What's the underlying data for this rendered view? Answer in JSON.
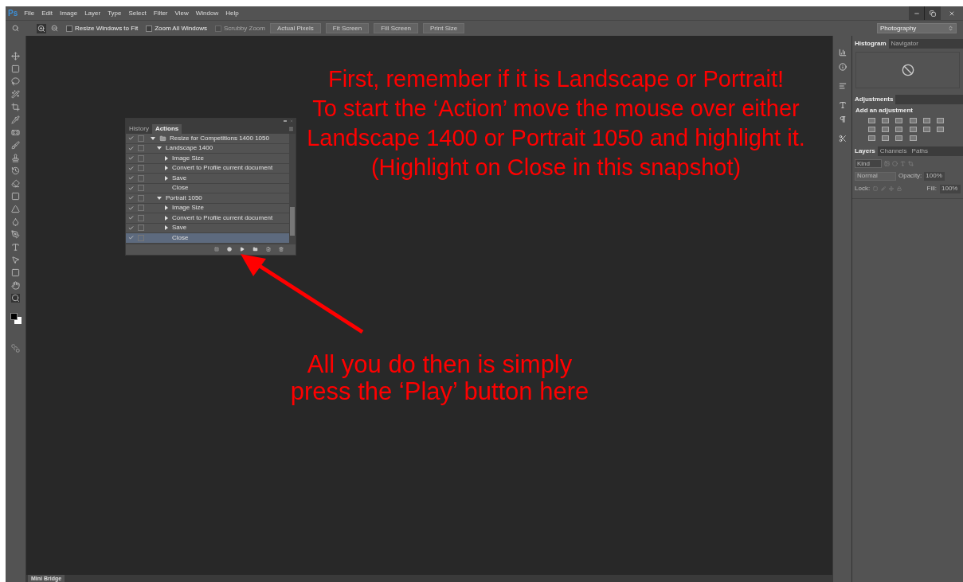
{
  "menu_bar": {
    "logo": "Ps",
    "items": [
      "File",
      "Edit",
      "Image",
      "Layer",
      "Type",
      "Select",
      "Filter",
      "View",
      "Window",
      "Help"
    ]
  },
  "options_bar": {
    "checkboxes": [
      {
        "label": "Resize Windows to Fit",
        "checked": false,
        "disabled": false
      },
      {
        "label": "Zoom All Windows",
        "checked": false,
        "disabled": false
      },
      {
        "label": "Scrubby Zoom",
        "checked": false,
        "disabled": true
      }
    ],
    "buttons": [
      "Actual Pixels",
      "Fit Screen",
      "Fill Screen",
      "Print Size"
    ],
    "workspace": "Photography"
  },
  "actions_panel": {
    "tabs": [
      {
        "label": "History",
        "selected": false
      },
      {
        "label": "Actions",
        "selected": true
      }
    ],
    "rows": [
      {
        "label": "Resize for Competitions  1400  1050",
        "kind": "set",
        "checked": true,
        "expanded": true,
        "selected": false,
        "children": [
          {
            "label": "Landscape 1400",
            "kind": "action",
            "checked": true,
            "expanded": true,
            "selected": false,
            "children": [
              {
                "label": "Image Size",
                "kind": "step",
                "checked": true,
                "has_details": true,
                "selected": false
              },
              {
                "label": "Convert to Profile current document",
                "kind": "step",
                "checked": true,
                "has_details": true,
                "selected": false
              },
              {
                "label": "Save",
                "kind": "step",
                "checked": true,
                "has_details": true,
                "selected": false
              },
              {
                "label": "Close",
                "kind": "step",
                "checked": true,
                "has_details": false,
                "selected": false
              }
            ]
          },
          {
            "label": "Portrait 1050",
            "kind": "action",
            "checked": true,
            "expanded": true,
            "selected": false,
            "children": [
              {
                "label": "Image Size",
                "kind": "step",
                "checked": true,
                "has_details": true,
                "selected": false
              },
              {
                "label": "Convert to Profile current document",
                "kind": "step",
                "checked": true,
                "has_details": true,
                "selected": false
              },
              {
                "label": "Save",
                "kind": "step",
                "checked": true,
                "has_details": true,
                "selected": false
              },
              {
                "label": "Close",
                "kind": "step",
                "checked": true,
                "has_details": false,
                "selected": true
              }
            ]
          }
        ]
      }
    ]
  },
  "annotations": [
    "First, remember if it is Landscape or Portrait!\nTo start the ‘Action’ move the mouse over either\nLandscape 1400 or Portrait 1050 and highlight it.\n(Highlight on Close in this snapshot)",
    "All you do then is simply\npress the ‘Play’ button here"
  ],
  "right_panels": {
    "top_tabs": [
      {
        "label": "Histogram",
        "selected": true
      },
      {
        "label": "Navigator",
        "selected": false
      }
    ],
    "adjustments": {
      "tab": "Adjustments",
      "heading": "Add an adjustment"
    },
    "layer_tabs": [
      {
        "label": "Layers",
        "selected": true
      },
      {
        "label": "Channels",
        "selected": false
      },
      {
        "label": "Paths",
        "selected": false
      }
    ],
    "filter_kind": "Kind",
    "blend_mode": "Normal",
    "opacity_label": "Opacity:",
    "opacity": "100%",
    "lock_label": "Lock:",
    "fill_label": "Fill:",
    "fill": "100%"
  },
  "bottom_bar": {
    "tab": "Mini Bridge"
  }
}
